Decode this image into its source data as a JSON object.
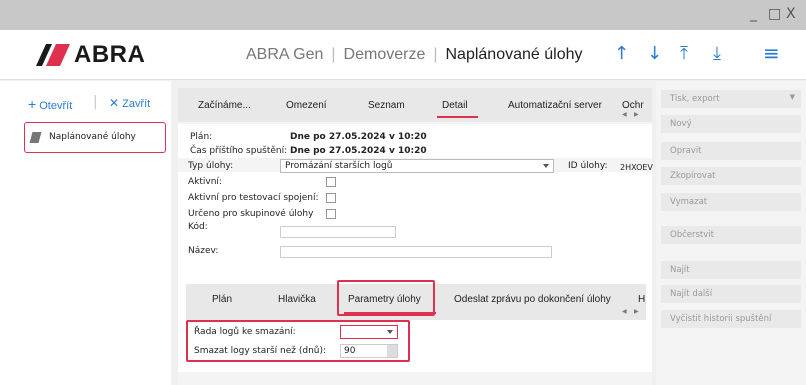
{
  "window": {
    "minimize": "_",
    "maximize": "□",
    "close": "X"
  },
  "header": {
    "logo": "ABRA",
    "breadcrumb": [
      "ABRA Gen",
      "Demoverze",
      "Naplánované úlohy"
    ],
    "icons": [
      "arrow-up-icon",
      "arrow-down-icon",
      "arrow-to-top-icon",
      "arrow-to-bottom-icon",
      "menu-icon"
    ]
  },
  "left": {
    "open_label": "Otevřít",
    "close_label": "Zavřít",
    "items": [
      {
        "label": "Naplánované úlohy"
      }
    ]
  },
  "tabs": [
    "Začínáme...",
    "Omezení",
    "Seznam",
    "Detail",
    "Automatizační server",
    "Ochr"
  ],
  "active_tab": "Detail",
  "plan": {
    "plan_label": "Plán:",
    "plan_value": "Dne po 27.05.2024 v 10:20",
    "next_label": "Čas příštího spuštění:",
    "next_value": "Dne po 27.05.2024 v 10:20"
  },
  "form": {
    "type_label": "Typ úlohy:",
    "type_value": "Promázání starších logů",
    "id_label": "ID úlohy:",
    "id_value": "2HXOEV",
    "active_label": "Aktivní:",
    "active_test_label": "Aktivní pro testovací spojení:",
    "group_label": "Určeno pro skupinové úlohy",
    "code_label": "Kód:",
    "name_label": "Název:"
  },
  "subtabs": [
    "Plán",
    "Hlavička",
    "Parametry úlohy",
    "Odeslat zprávu po dokončení úlohy",
    "H"
  ],
  "active_subtab": "Parametry úlohy",
  "params": {
    "series_label": "Řada logů ke smazání:",
    "series_value": "",
    "older_label": "Smazat logy starší než (dnů):",
    "older_value": "90"
  },
  "right": {
    "items": [
      "Tisk, export",
      "Nový",
      "Opravit",
      "Zkopírovat",
      "Vymazat",
      "Občerstvit",
      "Najít",
      "Najít další",
      "Vyčistit historii spuštění"
    ]
  },
  "colors": {
    "accent": "#e0304f",
    "link": "#2a7bd5"
  }
}
